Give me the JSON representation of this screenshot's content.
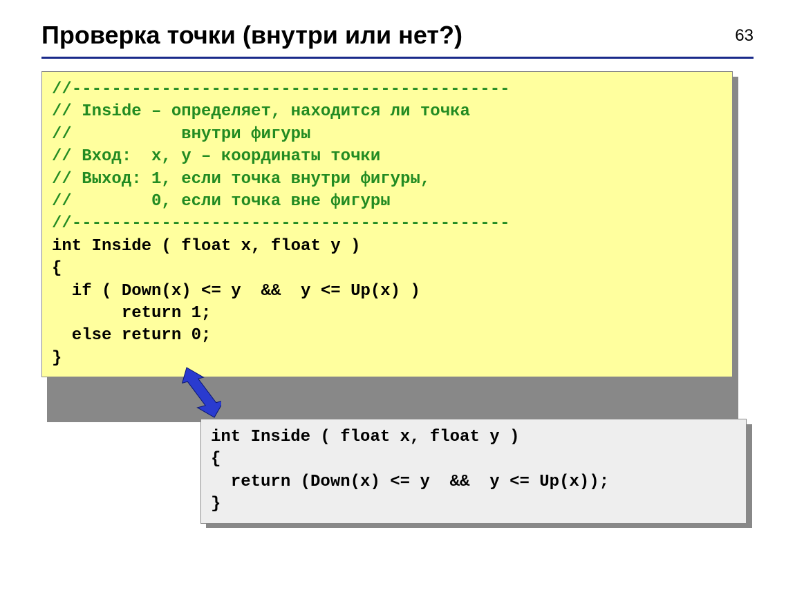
{
  "page_number": "63",
  "title": "Проверка точки (внутри или нет?)",
  "code1": {
    "c1": "//--------------------------------------------",
    "c2": "// Inside – определяет, находится ли точка",
    "c3": "//           внутри фигуры",
    "c4": "// Вход:  x, y – координаты точки",
    "c5": "// Выход: 1, если точка внутри фигуры,",
    "c6": "//        0, если точка вне фигуры",
    "c7": "//--------------------------------------------",
    "l1": "int Inside ( float x, float y )",
    "l2": "{",
    "l3": "  if ( Down(x) <= y  &&  y <= Up(x) )",
    "l4": "       return 1;",
    "l5": "  else return 0;",
    "l6": "}"
  },
  "code2": {
    "l1": "int Inside ( float x, float y )",
    "l2": "{",
    "l3": "  return (Down(x) <= y  &&  y <= Up(x));",
    "l4": "}"
  },
  "colors": {
    "rule": "#1a2a8a",
    "comment": "#228B22",
    "yellow_bg": "#ffff9e",
    "gray_bg": "#eeeeee",
    "arrow": "#2a3bcf"
  }
}
